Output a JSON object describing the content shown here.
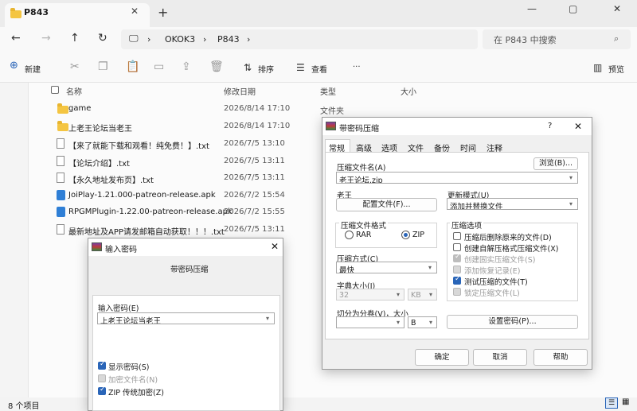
{
  "tab": {
    "title": "P843"
  },
  "nav": {
    "breadcrumb": [
      "OKOK3",
      "P843"
    ],
    "search_placeholder": "在 P843 中搜索"
  },
  "toolbar": {
    "new": "新建",
    "sort": "排序",
    "view": "查看",
    "more": "···",
    "preview": "预览"
  },
  "columns": {
    "name": "名称",
    "date": "修改日期",
    "type": "类型",
    "size": "大小"
  },
  "files": [
    {
      "name": "game",
      "date": "2026/8/14 17:10",
      "type": "文件夹",
      "kind": "folder"
    },
    {
      "name": "上老王论坛当老王",
      "date": "2026/8/14 17:10",
      "type": "",
      "kind": "folder"
    },
    {
      "name": "【来了就能下载和观看！纯免费！】.txt",
      "date": "2026/7/5 13:10",
      "type": "",
      "kind": "txt"
    },
    {
      "name": "【论坛介绍】.txt",
      "date": "2026/7/5 13:11",
      "type": "",
      "kind": "txt"
    },
    {
      "name": "【永久地址发布页】.txt",
      "date": "2026/7/5 13:11",
      "type": "",
      "kind": "txt"
    },
    {
      "name": "JoiPlay-1.21.000-patreon-release.apk",
      "date": "2026/7/2 15:54",
      "type": "",
      "kind": "apk"
    },
    {
      "name": "RPGMPlugin-1.22.00-patreon-release.apk",
      "date": "2026/7/2 15:55",
      "type": "",
      "kind": "apk"
    },
    {
      "name": "最新地址及APP请发邮箱自动获取！！！.txt",
      "date": "2026/7/5 13:11",
      "type": "",
      "kind": "txt"
    }
  ],
  "status": {
    "count": "8 个项目"
  },
  "archive_dialog": {
    "title": "带密码压缩",
    "help": "?",
    "tabs": [
      "常规",
      "高级",
      "选项",
      "文件",
      "备份",
      "时间",
      "注释"
    ],
    "archive_name_label": "压缩文件名(A)",
    "archive_name_value": "老王论坛.zip",
    "browse": "浏览(B)...",
    "profile_label": "老王",
    "profiles_button": "配置文件(F)...",
    "update_mode_label": "更新模式(U)",
    "update_mode_value": "添加并替换文件",
    "format_group": "压缩文件格式",
    "format_rar": "RAR",
    "format_zip": "ZIP",
    "selected_format": "ZIP",
    "method_label": "压缩方式(C)",
    "method_value": "最快",
    "dict_label": "字典大小(I)",
    "dict_value": "32",
    "dict_unit": "KB",
    "split_label": "切分为分卷(V)，大小",
    "split_value": "",
    "split_unit": "B",
    "options_group": "压缩选项",
    "options": [
      {
        "label": "压缩后删除原来的文件(D)",
        "checked": false,
        "disabled": false
      },
      {
        "label": "创建自解压格式压缩文件(X)",
        "checked": false,
        "disabled": false
      },
      {
        "label": "创建固实压缩文件(S)",
        "checked": true,
        "disabled": true
      },
      {
        "label": "添加恢复记录(E)",
        "checked": false,
        "disabled": true
      },
      {
        "label": "测试压缩的文件(T)",
        "checked": true,
        "disabled": false
      },
      {
        "label": "锁定压缩文件(L)",
        "checked": false,
        "disabled": true
      }
    ],
    "set_password": "设置密码(P)...",
    "ok": "确定",
    "cancel": "取消",
    "help_btn": "帮助"
  },
  "password_dialog": {
    "title": "输入密码",
    "subtitle": "带密码压缩",
    "input_label": "输入密码(E)",
    "input_value": "上老王论坛当老王",
    "options": [
      {
        "label": "显示密码(S)",
        "checked": true,
        "disabled": false
      },
      {
        "label": "加密文件名(N)",
        "checked": false,
        "disabled": true
      },
      {
        "label": "ZIP 传统加密(Z)",
        "checked": true,
        "disabled": false
      }
    ]
  },
  "colors": {
    "accent": "#2a65b8",
    "folder": "#f4c542",
    "apk": "#2f7fd6"
  }
}
